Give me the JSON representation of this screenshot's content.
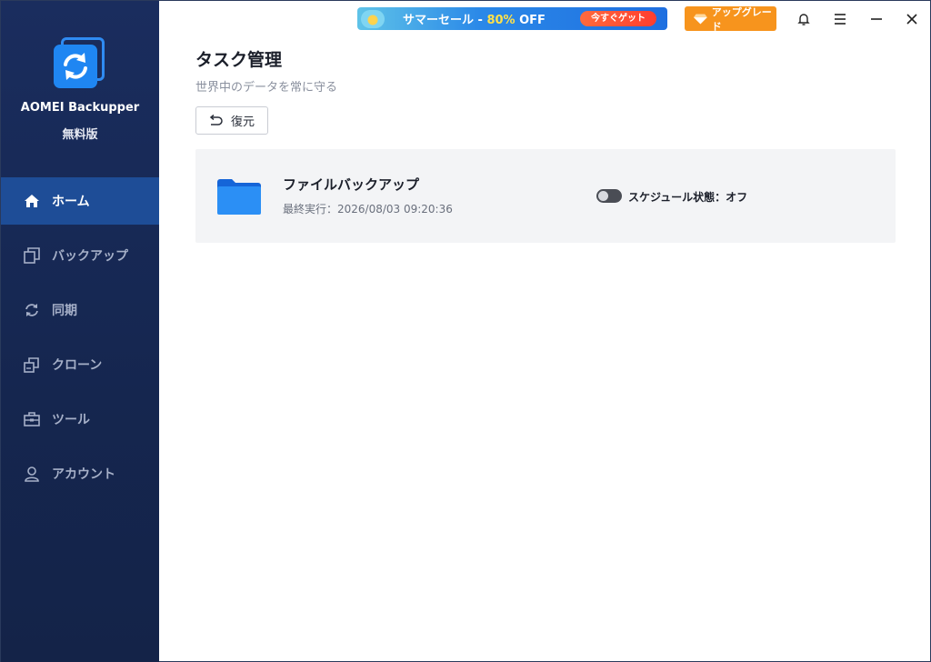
{
  "app": {
    "name": "AOMEI Backupper",
    "edition": "無料版"
  },
  "sidebar": {
    "items": [
      {
        "label": "ホーム",
        "icon": "home-icon",
        "active": true
      },
      {
        "label": "バックアップ",
        "icon": "backup-icon",
        "active": false
      },
      {
        "label": "同期",
        "icon": "sync-icon",
        "active": false
      },
      {
        "label": "クローン",
        "icon": "clone-icon",
        "active": false
      },
      {
        "label": "ツール",
        "icon": "toolbox-icon",
        "active": false
      },
      {
        "label": "アカウント",
        "icon": "user-icon",
        "active": false
      }
    ]
  },
  "topbar": {
    "promo_text": "サマーセール - ",
    "promo_pct": "80%",
    "promo_off": " OFF",
    "promo_cta": "今すぐゲット",
    "upgrade_label": "アップグレード"
  },
  "main": {
    "title": "タスク管理",
    "subtitle": "世界中のデータを常に守る",
    "restore_label": "復元",
    "task": {
      "name": "ファイルバックアップ",
      "last_run": "最終実行：2026/08/03 09:20:36",
      "schedule_status": "スケジュール状態：オフ",
      "schedule_on": false
    }
  },
  "colors": {
    "sidebar_bg": "#15264f",
    "active_item": "#1e4d97",
    "accent": "#1f86f2",
    "upgrade": "#f7941d"
  }
}
